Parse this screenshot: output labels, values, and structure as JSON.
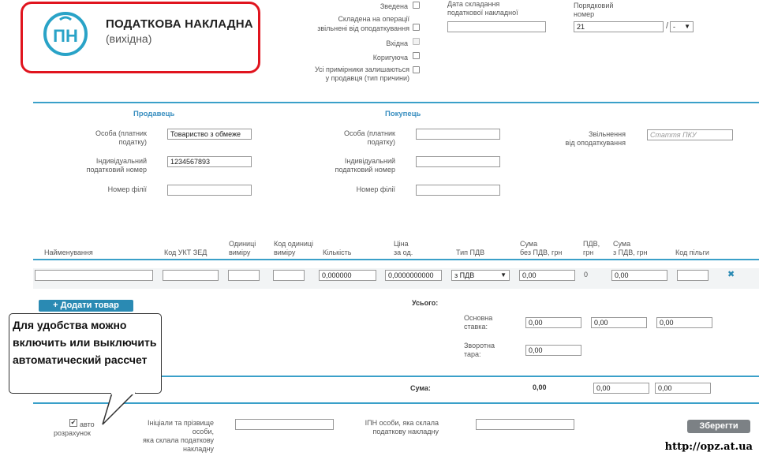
{
  "header": {
    "title": "ПОДАТКОВА НАКЛАДНА",
    "subtitle": "(вихідна)",
    "logo_text": "ПН",
    "logo_color": "#29a3c7",
    "frame_color": "#e0141e"
  },
  "flags": {
    "zvedena": "Зведена",
    "exempt_line1": "Складена на операції",
    "exempt_line2": "звільнені від оподаткування",
    "vkhidna": "Вхідна",
    "koryguyucha": "Коригуюча",
    "copies_line1": "Усі примірники залишаються",
    "copies_line2": "у продавця (тип причини)"
  },
  "date": {
    "label_line1": "Дата складання",
    "label_line2": "податкової накладної",
    "value": ""
  },
  "number": {
    "label_line1": "Порядковий",
    "label_line2": "номер",
    "value": "21",
    "separator": "/",
    "select_value": "-"
  },
  "seller": {
    "title": "Продавець",
    "person_label_line1": "Особа (платник",
    "person_label_line2": "податку)",
    "person_value": "Товариство з обмеже",
    "ipn_label_line1": "Індивідуальний",
    "ipn_label_line2": "податковий номер",
    "ipn_value": "1234567893",
    "branch_label": "Номер філії",
    "branch_value": ""
  },
  "buyer": {
    "title": "Покупець",
    "person_label_line1": "Особа (платник",
    "person_label_line2": "податку)",
    "person_value": "",
    "ipn_label_line1": "Індивідуальний",
    "ipn_label_line2": "податковий номер",
    "ipn_value": "",
    "branch_label": "Номер філії",
    "branch_value": ""
  },
  "exemption": {
    "label_line1": "Звільнення",
    "label_line2": "від оподаткування",
    "placeholder": "Стаття ПКУ"
  },
  "table": {
    "col_name": "Найменування",
    "col_ukt": "Код УКТ ЗЕД",
    "col_unit_line1": "Одиниці",
    "col_unit_line2": "виміру",
    "col_unitcode_line1": "Код одиниці",
    "col_unitcode_line2": "виміру",
    "col_qty": "Кількість",
    "col_price_line1": "Ціна",
    "col_price_line2": "за од.",
    "col_vat_type": "Тип ПДВ",
    "col_sum_novat_line1": "Сума",
    "col_sum_novat_line2": "без ПДВ, грн",
    "col_vat_line1": "ПДВ,",
    "col_vat_line2": "грн",
    "col_sum_vat_line1": "Сума",
    "col_sum_vat_line2": "з ПДВ, грн",
    "col_benefit": "Код пільги",
    "row": {
      "name": "",
      "ukt": "",
      "unit": "",
      "unit_code": "",
      "qty": "0,000000",
      "price": "0,0000000000",
      "vat_type": "з ПДВ",
      "sum_novat": "0,00",
      "vat": "0",
      "sum_vat": "0,00",
      "benefit": ""
    }
  },
  "add_button": "+ Додати товар",
  "totals": {
    "label": "Усього:",
    "basic_label_line1": "Основна",
    "basic_label_line2": "ставка:",
    "basic_values": [
      "0,00",
      "0,00",
      "0,00"
    ],
    "return_label_line1": "Зворотна",
    "return_label_line2": "тара:",
    "return_value": "0,00",
    "sum_label": "Сума:",
    "sum_text": "0,00",
    "sum_values": [
      "0,00",
      "0,00"
    ]
  },
  "tooltip": {
    "line1": "Для удобства можно",
    "line2": "включить или выключить",
    "line3": "автоматический рассчет"
  },
  "footer": {
    "auto_line1": "авто",
    "auto_line2": "розрахунок",
    "initials_line1": "Ініціали та прізвище",
    "initials_line2": "особи,",
    "initials_line3": "яка склала податкову",
    "initials_line4": "накладну",
    "ipn_line1": "ІПН особи, яка склала",
    "ipn_line2": "податкову накладну",
    "save_button": "Зберегти"
  },
  "watermark": "http://opz.at.ua"
}
